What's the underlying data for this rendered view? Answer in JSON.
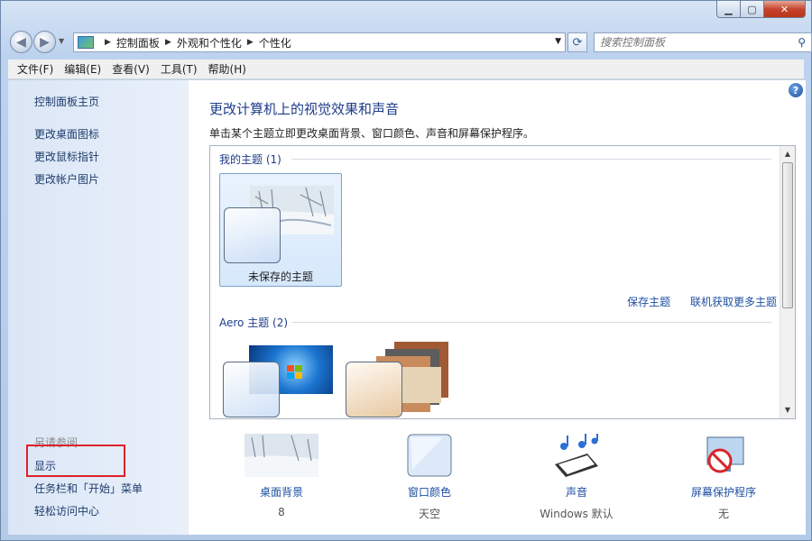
{
  "window": {
    "min_glyph": "▁",
    "max_glyph": "▢",
    "close_glyph": "✕"
  },
  "address": {
    "crumbs": [
      "控制面板",
      "外观和个性化",
      "个性化"
    ]
  },
  "search": {
    "placeholder": "搜索控制面板"
  },
  "menu": {
    "file": "文件(F)",
    "edit": "编辑(E)",
    "view": "查看(V)",
    "tools": "工具(T)",
    "help": "帮助(H)"
  },
  "sidebar": {
    "home": "控制面板主页",
    "items": [
      "更改桌面图标",
      "更改鼠标指针",
      "更改帐户图片"
    ],
    "see_also_title": "另请参阅",
    "see_also": [
      "显示",
      "任务栏和「开始」菜单",
      "轻松访问中心"
    ]
  },
  "main": {
    "heading": "更改计算机上的视觉效果和声音",
    "subtext": "单击某个主题立即更改桌面背景、窗口颜色、声音和屏幕保护程序。",
    "my_themes_title": "我的主题 (1)",
    "unsaved_theme": "未保存的主题",
    "save_theme": "保存主题",
    "get_more": "联机获取更多主题",
    "aero_title": "Aero 主题 (2)"
  },
  "settings": [
    {
      "name": "桌面背景",
      "value": "8"
    },
    {
      "name": "窗口颜色",
      "value": "天空"
    },
    {
      "name": "声音",
      "value": "Windows 默认"
    },
    {
      "name": "屏幕保护程序",
      "value": "无"
    }
  ],
  "colors": {
    "link": "#1e50a2",
    "heading": "#1e3c8c",
    "highlight_box": "#e0202a",
    "selected_tile": "#d6e8fb"
  }
}
